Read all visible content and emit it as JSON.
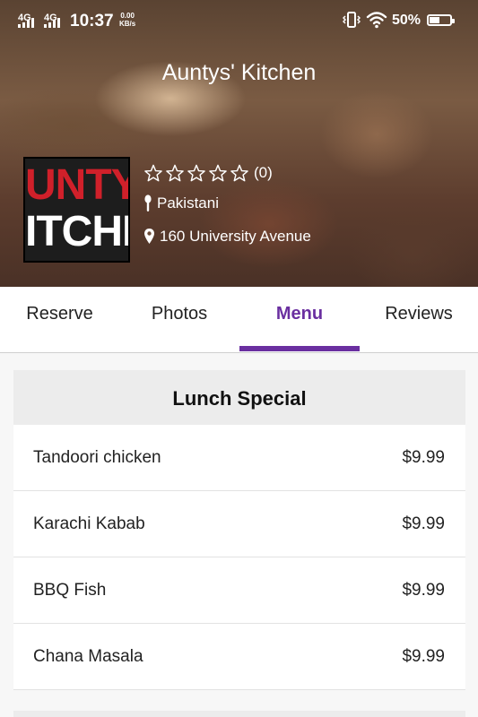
{
  "status_bar": {
    "network1": "4G",
    "network2": "4G",
    "time": "10:37",
    "speed_value": "0.00",
    "speed_unit": "KB/s",
    "battery": "50%",
    "battery_level": 0.5
  },
  "restaurant": {
    "name": "Auntys' Kitchen",
    "logo_line1": "UNTY",
    "logo_line2": "ITCHE",
    "rating_stars": 0,
    "rating_count": "(0)",
    "cuisine": "Pakistani",
    "address": "160 University Avenue"
  },
  "tabs": [
    {
      "label": "Reserve",
      "active": false
    },
    {
      "label": "Photos",
      "active": false
    },
    {
      "label": "Menu",
      "active": true
    },
    {
      "label": "Reviews",
      "active": false
    }
  ],
  "menu": {
    "section_title": "Lunch Special",
    "items": [
      {
        "name": "Tandoori chicken",
        "price": "$9.99"
      },
      {
        "name": "Karachi Kabab",
        "price": "$9.99"
      },
      {
        "name": "BBQ Fish",
        "price": "$9.99"
      },
      {
        "name": "Chana Masala",
        "price": "$9.99"
      }
    ]
  },
  "colors": {
    "accent": "#6a2fa0",
    "logo_red": "#d0202a"
  },
  "icons": [
    "vibrate-icon",
    "wifi-icon",
    "battery-icon",
    "star-outline-icon",
    "spoon-icon",
    "location-pin-icon"
  ]
}
